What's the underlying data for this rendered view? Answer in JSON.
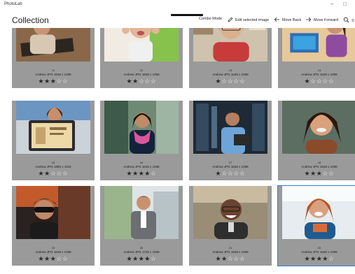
{
  "window": {
    "app_name": "PhotoLab",
    "minimize_glyph": "–",
    "maximize_glyph": "□"
  },
  "toolbar": {
    "title": "Collection",
    "combo_mode": "Combo Mode",
    "edit_selected": "Edit selected image",
    "edit_icon": "pencil-icon",
    "move_back": "Move Back",
    "move_back_icon": "arrow-left-icon",
    "move_forward": "Move Forward",
    "move_forward_icon": "arrow-right-icon",
    "search_icon": "search-icon",
    "overflow_label": "S"
  },
  "accent_color": "#2f7fd6",
  "rating_max": 5,
  "photos": [
    {
      "name": "11",
      "meta": "Andrew JPG  1648 x 1098",
      "rating": 3,
      "selected": false
    },
    {
      "name": "12",
      "meta": "Andrew JPG  1648 x 1098",
      "rating": 2,
      "selected": false
    },
    {
      "name": "13",
      "meta": "Andrew JPG  1648 x 1098",
      "rating": 1,
      "selected": false
    },
    {
      "name": "14",
      "meta": "Andrew JPG  1648 x 1098",
      "rating": 1,
      "selected": false
    },
    {
      "name": "15",
      "meta": "Andrew JPG  1880 x 1153",
      "rating": 2,
      "selected": false
    },
    {
      "name": "16",
      "meta": "Andrew JPG  1648 x 1098",
      "rating": 4,
      "selected": false
    },
    {
      "name": "17",
      "meta": "Andrew JPG  1648 x 1098",
      "rating": 1,
      "selected": false
    },
    {
      "name": "18",
      "meta": "Andrew JPG  1648 x 1098",
      "rating": 3,
      "selected": false
    },
    {
      "name": "19",
      "meta": "Andrew JPG  1648 x 1098",
      "rating": 3,
      "selected": false
    },
    {
      "name": "20",
      "meta": "Andrew JPG  1728 x 1098",
      "rating": 4,
      "selected": false
    },
    {
      "name": "21",
      "meta": "Andrew JPG  1648 x 1098",
      "rating": 2,
      "selected": false
    },
    {
      "name": "22",
      "meta": "Andrew JPG  1648 x 1098",
      "rating": 4,
      "selected": true
    }
  ]
}
